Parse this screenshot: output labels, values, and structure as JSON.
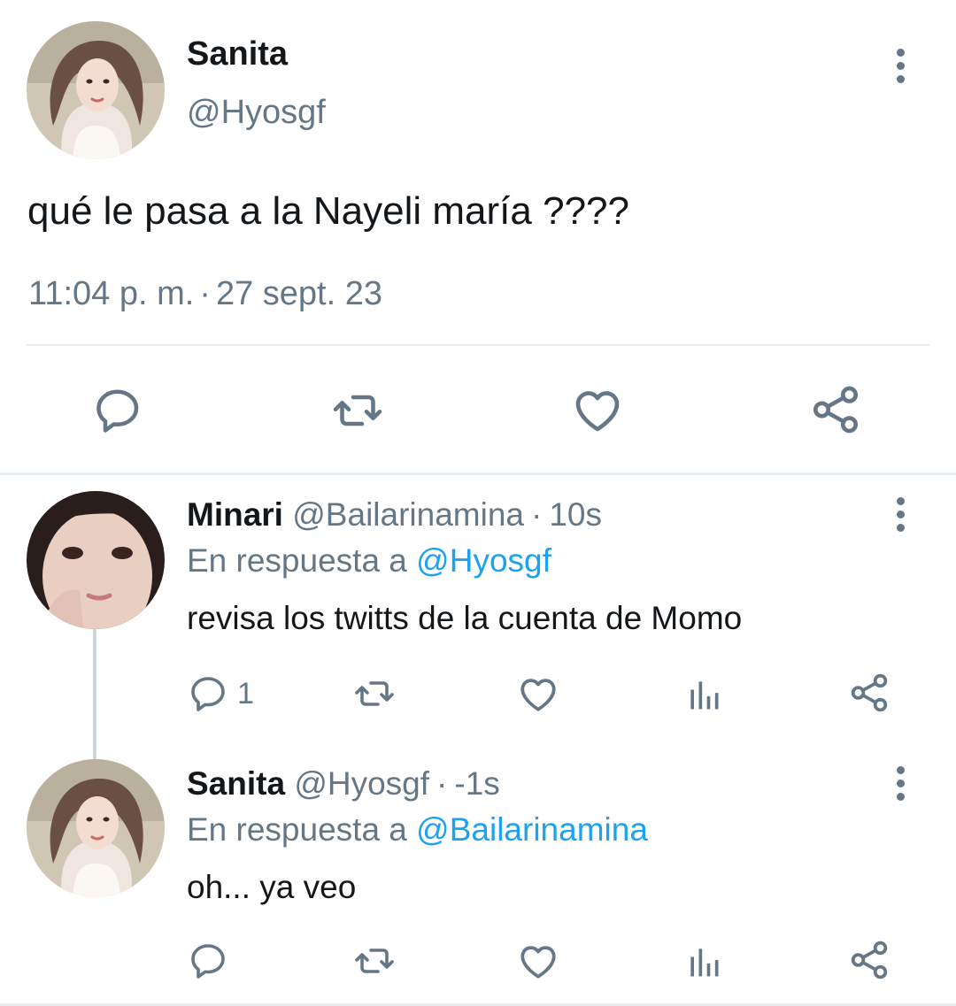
{
  "main_tweet": {
    "display_name": "Sanita",
    "handle": "@Hyosgf",
    "text": "qué le pasa a la Nayeli maría ????",
    "time": "11:04 p. m.",
    "separator": "·",
    "date": "27 sept. 23",
    "actions": [
      "reply-icon",
      "retweet-icon",
      "like-icon",
      "share-icon"
    ]
  },
  "replies": [
    {
      "display_name": "Minari",
      "handle": "@Bailarinamina",
      "separator": "·",
      "time": "10s",
      "in_reply_prefix": "En respuesta a",
      "in_reply_to": "@Hyosgf",
      "text": "revisa los twitts de la cuenta de Momo",
      "reply_count": "1",
      "actions": [
        "reply-icon",
        "retweet-icon",
        "like-icon",
        "analytics-icon",
        "share-icon"
      ]
    },
    {
      "display_name": "Sanita",
      "handle": "@Hyosgf",
      "separator": "·",
      "time": "-1s",
      "in_reply_prefix": "En respuesta a",
      "in_reply_to": "@Bailarinamina",
      "text": "oh... ya veo",
      "reply_count": "",
      "actions": [
        "reply-icon",
        "retweet-icon",
        "like-icon",
        "analytics-icon",
        "share-icon"
      ]
    }
  ],
  "colors": {
    "text_primary": "#14171a",
    "text_secondary": "#657786",
    "link": "#1da1f2",
    "divider": "#e6ecf0",
    "icon": "#657786"
  }
}
